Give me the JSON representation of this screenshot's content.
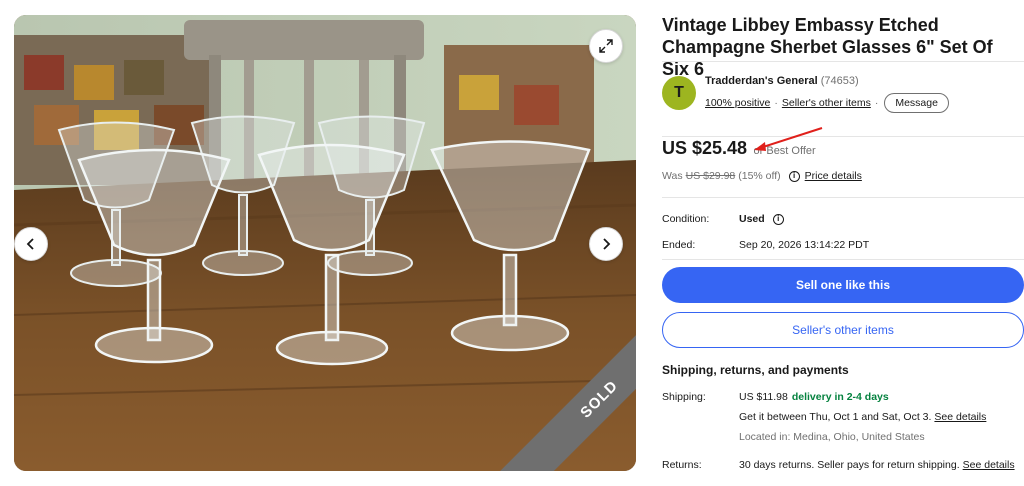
{
  "listing": {
    "title": "Vintage Libbey Embassy Etched Champagne Sherbet Glasses 6\" Set Of Six 6",
    "sold_label": "SOLD"
  },
  "seller": {
    "avatar_letter": "T",
    "name": "Tradderdan's General",
    "score": "(74653)",
    "positive": "100% positive",
    "separator": "·",
    "other_items_link": "Seller's other items",
    "message_button": "Message"
  },
  "price": {
    "amount": "US $25.48",
    "best_offer": "or Best Offer",
    "was_label": "Was",
    "was_price": "US $29.98",
    "discount": "(15% off)",
    "details_link": "Price details"
  },
  "details": {
    "condition_label": "Condition:",
    "condition_value": "Used",
    "ended_label": "Ended:",
    "ended_value": "Sep 20, 2026 13:14:22 PDT"
  },
  "actions": {
    "sell_one": "Sell one like this",
    "seller_other_items": "Seller's other items"
  },
  "shipping": {
    "section_title": "Shipping, returns, and payments",
    "shipping_label": "Shipping:",
    "shipping_cost": "US $11.98",
    "delivery": "delivery in 2-4 days",
    "get_it": "Get it between Thu, Oct 1 and Sat, Oct 3.",
    "see_details": "See details",
    "located": "Located in: Medina, Ohio, United States",
    "returns_label": "Returns:",
    "returns_text": "30 days returns. Seller pays for return shipping.",
    "returns_see_details": "See details"
  },
  "icons": {
    "expand": "expand-icon",
    "prev": "chevron-left-icon",
    "next": "chevron-right-icon",
    "info": "info-icon"
  },
  "colors": {
    "primary_blue": "#3665f3",
    "green": "#05823f",
    "avatar": "#9db520",
    "annotation_red": "#e0201b"
  }
}
